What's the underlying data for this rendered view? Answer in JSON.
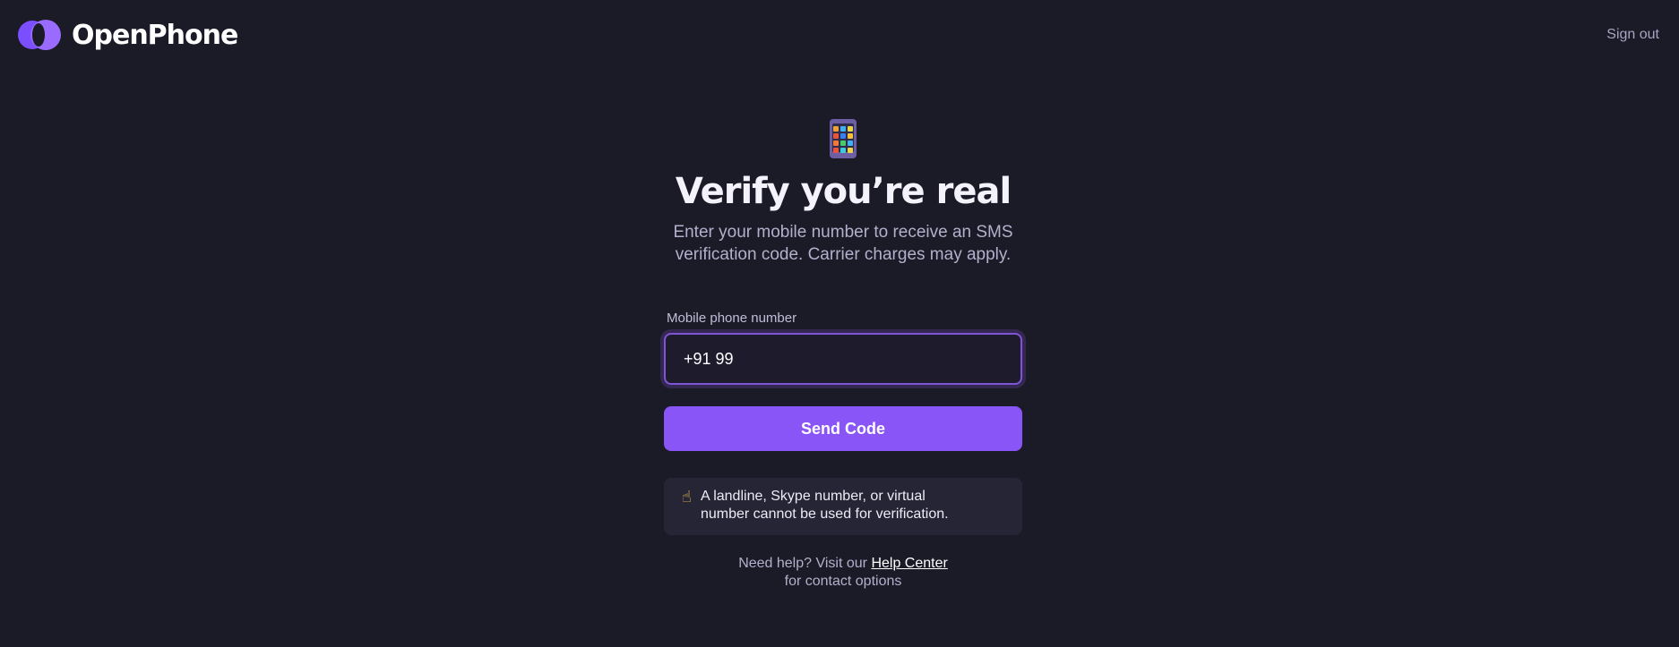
{
  "header": {
    "brand_name": "OpenPhone",
    "sign_out_label": "Sign out"
  },
  "main": {
    "icon": "mobile-phone-icon",
    "title": "Verify you’re real",
    "subtitle_line1": "Enter your mobile number to receive an SMS",
    "subtitle_line2": "verification code. Carrier charges may apply.",
    "phone_field": {
      "label": "Mobile phone number",
      "value": "+91 99"
    },
    "send_button_label": "Send Code",
    "notice": {
      "icon": "pointing-finger-icon",
      "line1": "A landline, Skype number, or virtual",
      "line2": "number cannot be used for verification."
    },
    "help": {
      "prefix": "Need help? Visit our",
      "link_label": "Help Center",
      "suffix": "for contact options"
    }
  },
  "colors": {
    "background": "#1b1a27",
    "accent": "#8a55f7",
    "notice_bg": "#262536"
  }
}
